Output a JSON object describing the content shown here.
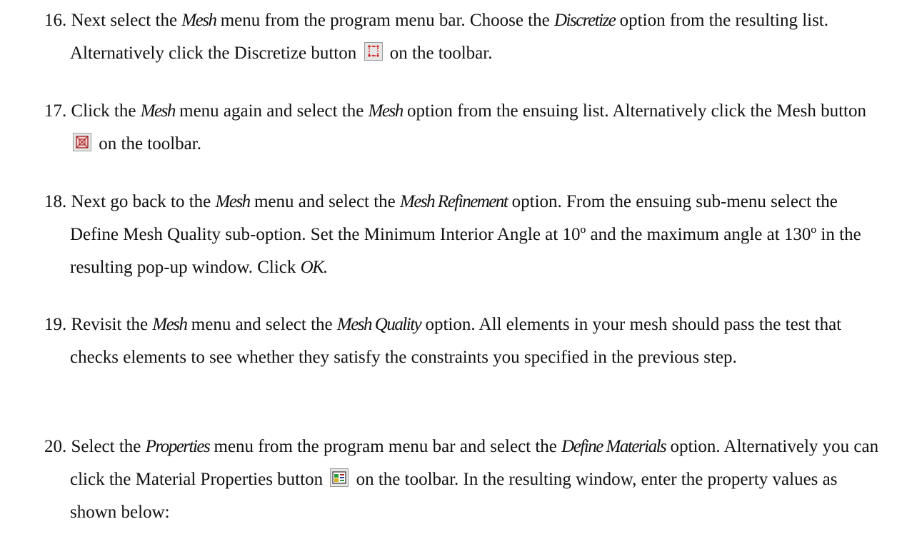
{
  "steps": [
    {
      "num": "16.",
      "p1": "Next select the ",
      "i1": "Mesh",
      "p2": " menu from the program menu bar. Choose the ",
      "i2": "Discretize",
      "p3": " option from the resulting list. Alternatively click the Discretize button ",
      "icon": "discretize-icon",
      "p4": " on the toolbar."
    },
    {
      "num": "17.",
      "p1": "Click the ",
      "i1": "Mesh",
      "p2": " menu again and select the ",
      "i2": "Mesh",
      "p3": " option from the ensuing list. Alternatively click the Mesh button ",
      "icon": "mesh-icon",
      "p4": " on the toolbar."
    },
    {
      "num": "18.",
      "p1": "Next go back to the ",
      "i1": "Mesh",
      "p2": " menu and select the ",
      "i2": "Mesh Refinement",
      "p3": " option. From the ensuing sub-menu select the Define Mesh Quality sub-option. Set the Minimum Interior Angle at 10º and the maximum angle at 130º in the resulting pop-up window. Click ",
      "i3": "OK",
      "p4": "."
    },
    {
      "num": "19.",
      "p1": "Revisit the ",
      "i1": "Mesh",
      "p2": " menu and select the ",
      "i2": "Mesh Quality",
      "p3": " option. All elements in your mesh should pass the test that checks elements to see whether they satisfy the constraints you specified in the previous step."
    },
    {
      "num": "20.",
      "p1": "Select the ",
      "i1": "Properties",
      "p2": " menu from the program menu bar and select the ",
      "i2": "Define Materials",
      "p3": " option. Alternatively you can click the Material Properties button ",
      "icon": "material-properties-icon",
      "p4": " on the toolbar. In the resulting window, enter the property values as shown below:"
    }
  ]
}
